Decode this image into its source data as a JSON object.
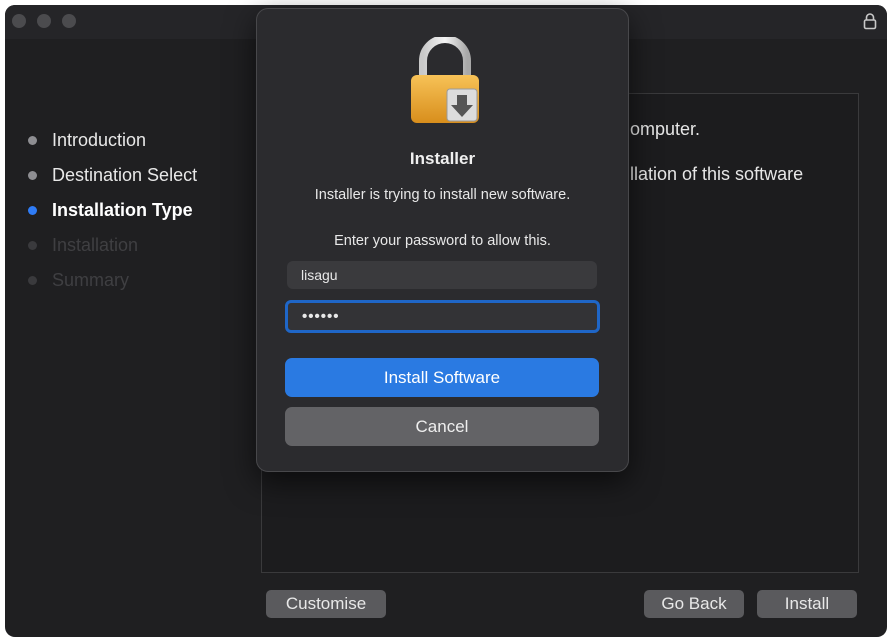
{
  "sidebar": {
    "steps": [
      {
        "label": "Introduction",
        "state": "done"
      },
      {
        "label": "Destination Select",
        "state": "done"
      },
      {
        "label": "Installation Type",
        "state": "current"
      },
      {
        "label": "Installation",
        "state": "pending"
      },
      {
        "label": "Summary",
        "state": "pending"
      }
    ]
  },
  "content": {
    "line1": "omputer.",
    "line2": "llation of this software"
  },
  "footer": {
    "customise_label": "Customise",
    "go_back_label": "Go Back",
    "install_label": "Install"
  },
  "dialog": {
    "title": "Installer",
    "message": "Installer is trying to install new software.",
    "prompt": "Enter your password to allow this.",
    "username_value": "lisagu",
    "password_value": "••••••",
    "install_software_label": "Install Software",
    "cancel_label": "Cancel"
  },
  "colors": {
    "accent": "#2a7ae2",
    "current_step_dot": "#2f7cf6",
    "window_bg": "#1f1f21",
    "dialog_bg": "#2b2b2e"
  },
  "icons": {
    "titlebar": "lock-icon",
    "dialog": "installer-lock-icon"
  }
}
